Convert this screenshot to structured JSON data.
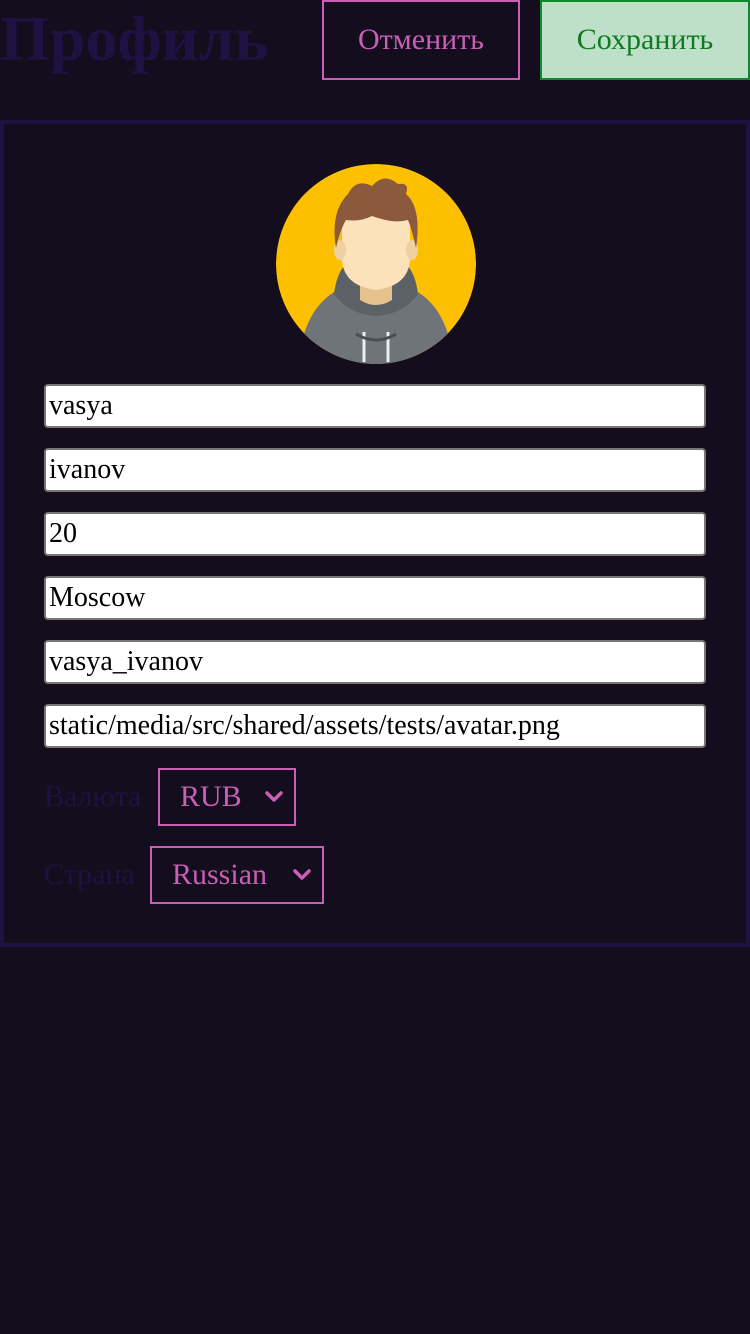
{
  "header": {
    "title": "Профиль",
    "cancel_label": "Отменить",
    "save_label": "Сохранить"
  },
  "profile": {
    "avatar_icon": "user-avatar-icon",
    "fields": {
      "first_name": "vasya",
      "last_name": "ivanov",
      "age": "20",
      "city": "Moscow",
      "username": "vasya_ivanov",
      "avatar_url": "static/media/src/shared/assets/tests/avatar.png"
    },
    "currency": {
      "label": "Валюта",
      "value": "RUB"
    },
    "country": {
      "label": "Страна",
      "value": "Russian"
    }
  },
  "colors": {
    "background": "#130d1d",
    "accent": "#c95fb6",
    "title": "#1f1142",
    "save_bg": "#bfe0c8",
    "save_text": "#0e7a22"
  }
}
